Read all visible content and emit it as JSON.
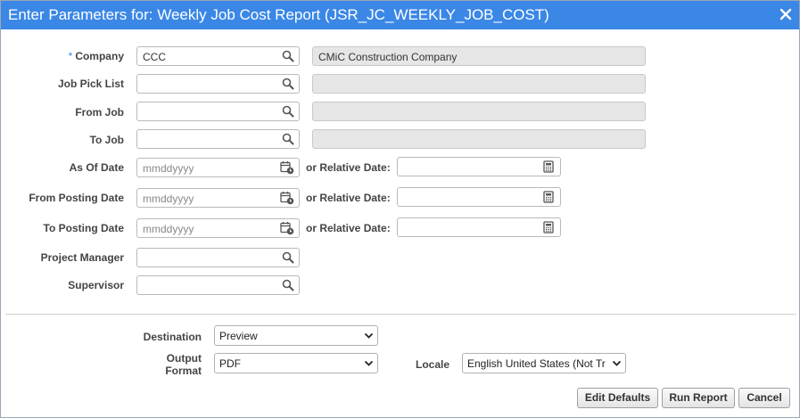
{
  "window": {
    "title": "Enter Parameters for: Weekly Job Cost Report (JSR_JC_WEEKLY_JOB_COST)",
    "close_icon": "close-icon"
  },
  "colors": {
    "titlebar": "#3a87e6",
    "required_marker": "#3a87e6"
  },
  "form": {
    "company": {
      "label": "Company",
      "required_marker": "*",
      "value": "CCC",
      "description": "CMiC Construction Company"
    },
    "job_pick_list": {
      "label": "Job Pick List",
      "value": "",
      "description": ""
    },
    "from_job": {
      "label": "From Job",
      "value": "",
      "description": ""
    },
    "to_job": {
      "label": "To Job",
      "value": "",
      "description": ""
    },
    "as_of_date": {
      "label": "As Of Date",
      "placeholder": "mmddyyyy",
      "relative_label": "or Relative Date:",
      "relative_value": ""
    },
    "from_posting_date": {
      "label": "From Posting Date",
      "placeholder": "mmddyyyy",
      "relative_label": "or Relative Date:",
      "relative_value": ""
    },
    "to_posting_date": {
      "label": "To Posting Date",
      "placeholder": "mmddyyyy",
      "relative_label": "or Relative Date:",
      "relative_value": ""
    },
    "project_manager": {
      "label": "Project Manager",
      "value": ""
    },
    "supervisor": {
      "label": "Supervisor",
      "value": ""
    }
  },
  "output": {
    "destination": {
      "label": "Destination",
      "value": "Preview"
    },
    "output_format": {
      "label_line1": "Output",
      "label_line2": "Format",
      "value": "PDF"
    },
    "locale": {
      "label": "Locale",
      "value": "English United States (Not Tr"
    }
  },
  "buttons": {
    "edit_defaults": "Edit Defaults",
    "run_report": "Run Report",
    "cancel": "Cancel"
  }
}
